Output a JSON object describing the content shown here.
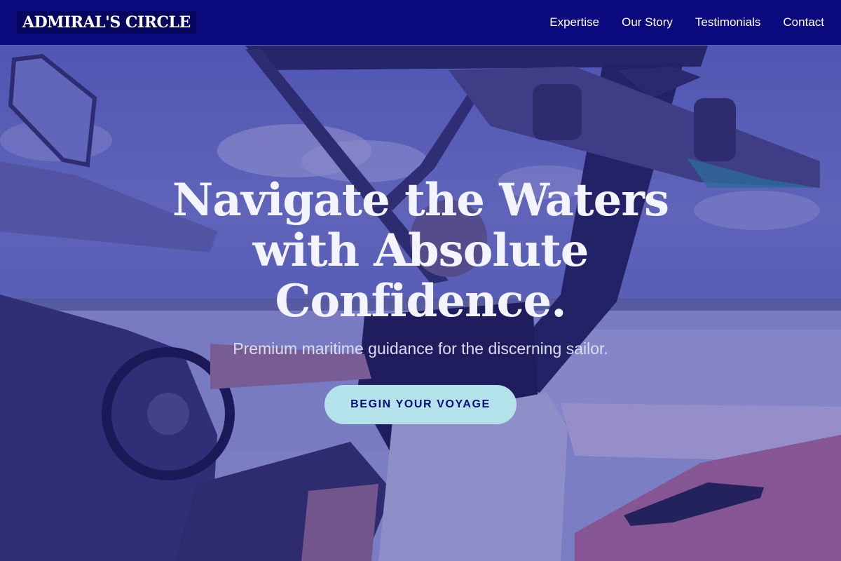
{
  "brand": {
    "name": "ADMIRAL'S CIRCLE"
  },
  "nav": {
    "links": [
      {
        "label": "Expertise"
      },
      {
        "label": "Our Story"
      },
      {
        "label": "Testimonials"
      },
      {
        "label": "Contact"
      }
    ]
  },
  "hero": {
    "title": "Navigate the Waters with Absolute Confidence.",
    "subtitle": "Premium maritime guidance for the discerning sailor.",
    "cta_label": "BEGIN YOUR VOYAGE",
    "image_alt": "Person driving a wake boat with wakeboards mounted on the tower"
  },
  "colors": {
    "navbar": "#0a0a7e",
    "cta_background": "#b3e2ea",
    "cta_text": "#0c0c7a",
    "hero_tint": "rgba(26, 20, 140, 0.38)"
  }
}
